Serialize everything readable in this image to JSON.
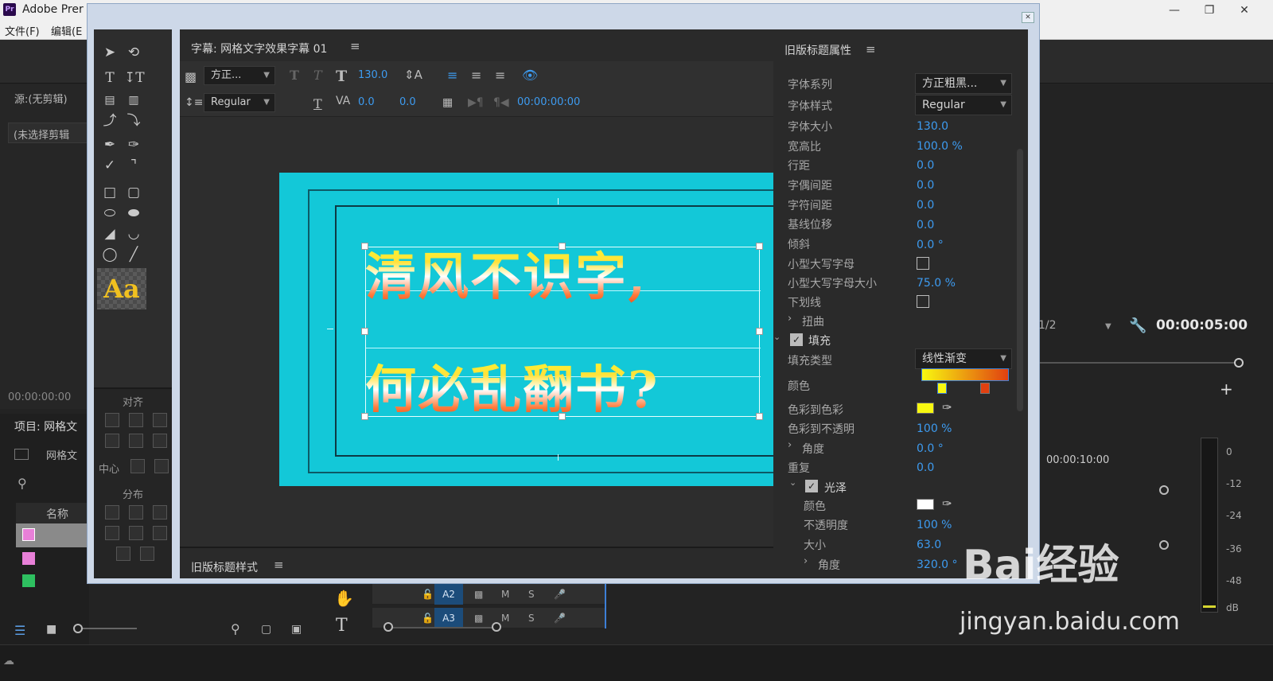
{
  "app": {
    "title": "Adobe Prer",
    "logo": "Pr",
    "menu": [
      "文件(F)",
      "编辑(E"
    ]
  },
  "source_panel": {
    "title": "源:(无剪辑)",
    "empty_text": "(未选择剪辑",
    "timecode": "00:00:00:00"
  },
  "project_panel": {
    "title": "项目: 网格文",
    "item": "网格文",
    "column": "名称"
  },
  "tools": {
    "align_label": "对齐",
    "center_label": "中心",
    "distribute_label": "分布",
    "style_sample": "Aa"
  },
  "editor": {
    "title": "字幕: 网格文字效果字幕 01",
    "font_family": "方正...",
    "font_style": "Regular",
    "font_size": "130.0",
    "leading": "0.0",
    "kerning": "0.0",
    "timecode": "00:00:00:00"
  },
  "caption": {
    "line1": "清风不识字,",
    "line2": "何必乱翻书?"
  },
  "footer": {
    "title": "旧版标题样式"
  },
  "props": {
    "title": "旧版标题属性",
    "rows": [
      {
        "label": "字体系列",
        "value": "方正粗黑..."
      },
      {
        "label": "字体样式",
        "value": "Regular"
      },
      {
        "label": "字体大小",
        "value": "130.0"
      },
      {
        "label": "宽高比",
        "value": "100.0 %"
      },
      {
        "label": "行距",
        "value": "0.0"
      },
      {
        "label": "字偶间距",
        "value": "0.0"
      },
      {
        "label": "字符间距",
        "value": "0.0"
      },
      {
        "label": "基线位移",
        "value": "0.0"
      },
      {
        "label": "倾斜",
        "value": "0.0 °"
      },
      {
        "label": "小型大写字母",
        "value": ""
      },
      {
        "label": "小型大写字母大小",
        "value": "75.0 %"
      },
      {
        "label": "下划线",
        "value": ""
      },
      {
        "label": "扭曲",
        "value": ""
      },
      {
        "label": "填充",
        "value": ""
      },
      {
        "label": "填充类型",
        "value": "线性渐变"
      },
      {
        "label": "颜色",
        "value": ""
      },
      {
        "label": "色彩到色彩",
        "value": ""
      },
      {
        "label": "色彩到不透明",
        "value": "100 %"
      },
      {
        "label": "角度",
        "value": "0.0 °"
      },
      {
        "label": "重复",
        "value": "0.0"
      },
      {
        "label": "光泽",
        "value": ""
      },
      {
        "label": "颜色",
        "value": ""
      },
      {
        "label": "不透明度",
        "value": "100 %"
      },
      {
        "label": "大小",
        "value": "63.0"
      },
      {
        "label": "角度",
        "value": "320.0 °"
      }
    ],
    "gradient_start": "#f8f810",
    "gradient_end": "#e04010",
    "sheen_color": "#ffffff"
  },
  "program": {
    "fraction": "1/2",
    "timecode": "00:00:05:00",
    "ruler_time": "00:00:10:00"
  },
  "meter": {
    "ticks": [
      "0",
      "-12",
      "-24",
      "-36",
      "-48",
      "dB"
    ]
  },
  "timeline": {
    "tracks": [
      {
        "name": "A2",
        "m": "M",
        "s": "S"
      },
      {
        "name": "A3",
        "m": "M",
        "s": "S"
      }
    ]
  },
  "watermark": {
    "main": "Bai经验",
    "sub": "jingyan.baidu.com"
  }
}
